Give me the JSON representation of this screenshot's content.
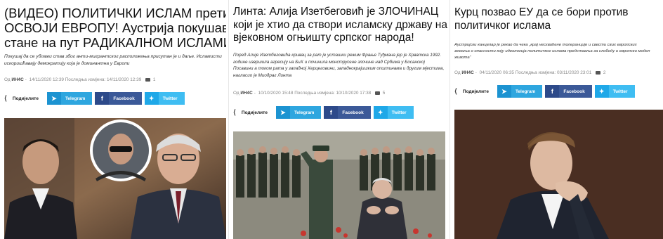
{
  "articles": [
    {
      "title_lines": [
        "(ВИДЕО) ПОЛИТИЧКИ ИСЛАМ прети да",
        "ОСВОЈИ ЕВРОПУ! Аустрија покушава да",
        "стане на пут РАДИКАЛНОМ ИСЛАМИЗМУ!"
      ],
      "dek_lines": [
        "Покушај да се ублажи став због анти-мигрантског расположења присутан је и даље. Исламисти",
        "искоришћавају демократију која је доминантна у Европи"
      ],
      "meta": {
        "by": "Од",
        "author": "ИН4С",
        "published": "14/11/2020 12:39",
        "modified_label": "Последња измјена:",
        "modified": "14/11/2020 12:39",
        "comments": "1"
      },
      "share": {
        "label": "Подијелите",
        "telegram": "Telegram",
        "facebook": "Facebook",
        "twitter": "Twitter"
      }
    },
    {
      "title_lines": [
        "Линта: Алија Изетбеговић је ЗЛОЧИНАЦ",
        "који је хтио да створи исламску државу на",
        "вјековном огњишту српског народа!"
      ],
      "dek_lines": [
        "Поред Алије Изетбеговића кривац за рат је усташки режим Фрање Туђмана јер је Хрватска 1992.",
        "године извршила агресију на БиХ и починила монструозне злочине над Србима у Босанској",
        "Посавини а током рата у западној Херцеговини, западнокрајишким општинама и другим мјестима,",
        "нагласио је Миодраг Линта"
      ],
      "meta": {
        "by": "Од",
        "author": "ИН4С",
        "published": "10/10/2020 15:48",
        "modified_label": "Последња измјена:",
        "modified": "10/10/2020 17:38",
        "comments": "5"
      },
      "share": {
        "label": "Подијелите",
        "telegram": "Telegram",
        "facebook": "Facebook",
        "twitter": "Twitter"
      }
    },
    {
      "title_lines": [
        "Курц позвао ЕУ да се бори против",
        "политичког ислама"
      ],
      "dek_lines": [
        "Аустријски канцелар је рекао да чека „крај несхваћене толеранције и свести свих европских",
        "земаља о опасности коју идеологија политичког ислама представља за слободу и европски модел",
        "живота“"
      ],
      "meta": {
        "by": "Од",
        "author": "ИН4С",
        "published": "04/11/2020 06:35",
        "modified_label": "Последња измјена:",
        "modified": "03/11/2020 23:01",
        "comments": "2"
      },
      "share": {
        "label": "Подијелите",
        "telegram": "Telegram",
        "facebook": "Facebook",
        "twitter": "Twitter"
      }
    }
  ],
  "colors": {
    "telegram": "#2ea6df",
    "facebook": "#3b5998",
    "twitter": "#3fbdf2"
  },
  "icons": {
    "share": "share-icon",
    "telegram": "telegram-icon",
    "facebook": "facebook-icon",
    "twitter": "twitter-icon",
    "comments": "comment-icon"
  }
}
